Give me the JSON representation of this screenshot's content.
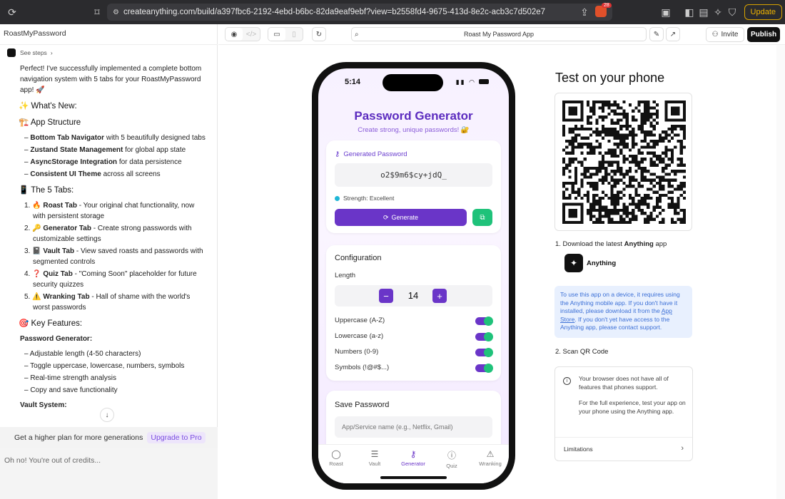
{
  "browser": {
    "url": "createanything.com/build/a397fbc6-2192-4ebd-b6bc-82da9eaf9ebf?view=b2558fd4-9675-413d-8e2c-acb3c7d502e7",
    "brave_badge": "28",
    "update_label": "Update"
  },
  "left": {
    "project_name": "RoastMyPassword",
    "see_steps": "See steps",
    "intro": "Perfect! I've successfully implemented a complete bottom navigation system with 5 tabs for your RoastMyPassword app! 🚀",
    "h_whats_new": "✨ What's New:",
    "h_structure": "🏗️ App Structure",
    "structure": [
      {
        "b": "Bottom Tab Navigator",
        "t": " with 5 beautifully designed tabs"
      },
      {
        "b": "Zustand State Management",
        "t": " for global app state"
      },
      {
        "b": "AsyncStorage Integration",
        "t": " for data persistence"
      },
      {
        "b": "Consistent UI Theme",
        "t": " across all screens"
      }
    ],
    "h_tabs": "📱 The 5 Tabs:",
    "tabs": [
      {
        "n": "1. 🔥 ",
        "b": "Roast Tab",
        "t": " - Your original chat functionality, now with persistent storage"
      },
      {
        "n": "2. 🔑 ",
        "b": "Generator Tab",
        "t": " - Create strong passwords with customizable settings"
      },
      {
        "n": "3. 📓 ",
        "b": "Vault Tab",
        "t": " - View saved roasts and passwords with segmented controls"
      },
      {
        "n": "4. ❓ ",
        "b": "Quiz Tab",
        "t": " - \"Coming Soon\" placeholder for future security quizzes"
      },
      {
        "n": "5. ⚠️ ",
        "b": "Wranking Tab",
        "t": " - Hall of shame with the world's worst passwords"
      }
    ],
    "h_features": "🎯 Key Features:",
    "h_pwgen": "Password Generator:",
    "features": [
      "Adjustable length (4-50 characters)",
      "Toggle uppercase, lowercase, numbers, symbols",
      "Real-time strength analysis",
      "Copy and save functionality"
    ],
    "h_vault": "Vault System:",
    "upgrade_text": "Get a higher plan for more generations",
    "upgrade_link": "Upgrade to Pro",
    "credits_text": "Oh no! You're out of credits..."
  },
  "toolbar": {
    "address": "Roast My Password App",
    "invite": "Invite",
    "publish": "Publish"
  },
  "phone": {
    "time": "5:14",
    "title": "Password Generator",
    "subtitle": "Create strong, unique passwords! 🔐",
    "gen_label": "Generated Password",
    "password": "o2$9m6$cy+jdQ_",
    "strength": "Strength: Excellent",
    "generate": "Generate",
    "config_title": "Configuration",
    "length_label": "Length",
    "length_value": "14",
    "options": [
      "Uppercase (A-Z)",
      "Lowercase (a-z)",
      "Numbers (0-9)",
      "Symbols (!@#$...)"
    ],
    "save_title": "Save Password",
    "save_placeholder": "App/Service name (e.g., Netflix, Gmail)",
    "tabs": [
      "Roast",
      "Vault",
      "Generator",
      "Quiz",
      "Wranking"
    ],
    "active_tab": "Generator"
  },
  "right": {
    "title": "Test on your phone",
    "step1_prefix": "1. Download the latest ",
    "step1_bold": "Anything",
    "step1_suffix": " app",
    "app_name": "Anything",
    "info_1": "To use this app on a device, it requires using the Anything mobile app. If you don't have it installed, please download it from the ",
    "info_link": "App Store",
    "info_2": ". If you don't yet have access to the Anything app, please contact support.",
    "step2": "2. Scan QR Code",
    "note_1": "Your browser does not have all of features that phones support.",
    "note_2": "For the full experience, test your app on your phone using the Anything app.",
    "limitations": "Limitations"
  }
}
